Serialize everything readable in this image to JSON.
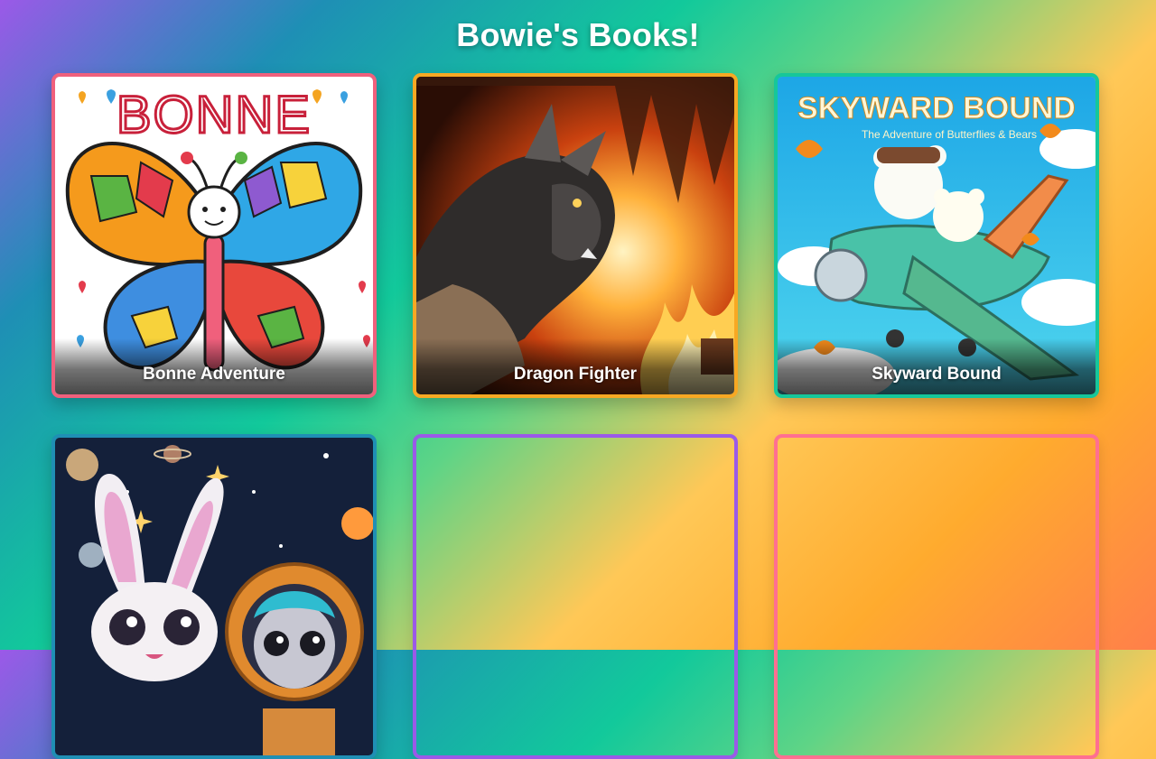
{
  "header": {
    "title": "Bowie's Books!"
  },
  "books": [
    {
      "title": "Bonne Adventure",
      "cover_text": "BONNE",
      "border_color": "#f0607c",
      "cover": "butterfly-illustration"
    },
    {
      "title": "Dragon Fighter",
      "border_color": "#f7a823",
      "cover": "dragon-illustration"
    },
    {
      "title": "Skyward Bound",
      "cover_text": "SKYWARD BOUND",
      "cover_subtitle": "The Adventure of Butterflies & Bears",
      "border_color": "#16c79a",
      "cover": "bears-airplane-illustration"
    },
    {
      "title": "",
      "border_color": "#1f8fb4",
      "cover": "bunny-astronaut-illustration"
    },
    {
      "title": "",
      "border_color": "#9b59e8",
      "cover": "empty"
    },
    {
      "title": "",
      "border_color": "#ff6f91",
      "cover": "empty"
    }
  ]
}
